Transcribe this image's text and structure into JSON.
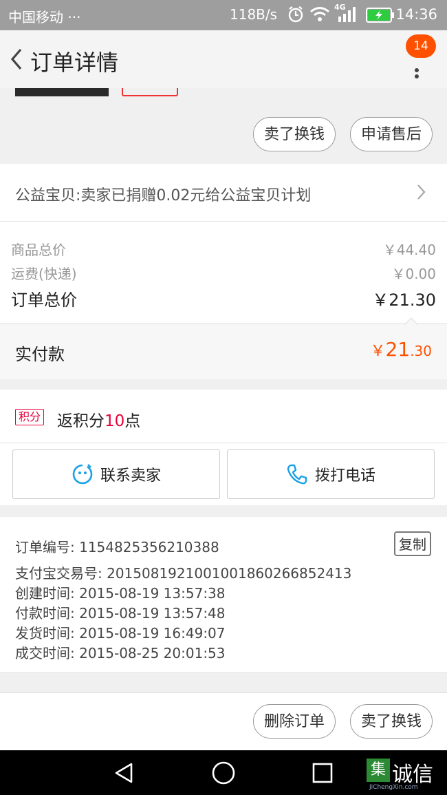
{
  "status_bar": {
    "carrier": "中国移动 ···",
    "speed": "118B/s",
    "network": "4G",
    "time": "14:36"
  },
  "header": {
    "title": "订单详情",
    "badge_count": "14"
  },
  "top_actions": {
    "sell_button": "卖了换钱",
    "after_sale_button": "申请售后"
  },
  "charity": {
    "text": "公益宝贝:卖家已捐赠0.02元给公益宝贝计划"
  },
  "prices": {
    "goods_label": "商品总价",
    "goods_value": "￥44.40",
    "shipping_label": "运费(快递)",
    "shipping_value": "￥0.00",
    "total_label": "订单总价",
    "total_value": "￥21.30"
  },
  "paid": {
    "label": "实付款",
    "currency": "￥",
    "integer": "21",
    "decimal": ".30"
  },
  "points": {
    "tag": "积分",
    "prefix": "返积分",
    "amount": "10",
    "suffix": "点"
  },
  "contact": {
    "seller_label": "联系卖家",
    "call_label": "拨打电话"
  },
  "order_info": {
    "copy_button": "复制",
    "lines": [
      "订单编号: 1154825356210388",
      "支付宝交易号: 2015081921001001860266852413",
      "创建时间: 2015-08-19 13:57:38",
      "付款时间: 2015-08-19 13:57:48",
      "发货时间: 2015-08-19 16:49:07",
      "成交时间: 2015-08-25 20:01:53"
    ]
  },
  "bottom_actions": {
    "delete_button": "删除订单",
    "sell_button": "卖了换钱"
  },
  "watermark": {
    "name": "诚信",
    "domain": "JiChengXin.com"
  },
  "colors": {
    "accent": "#ff5000",
    "points_red": "#e4003a",
    "icon_blue": "#1aa0e6"
  }
}
